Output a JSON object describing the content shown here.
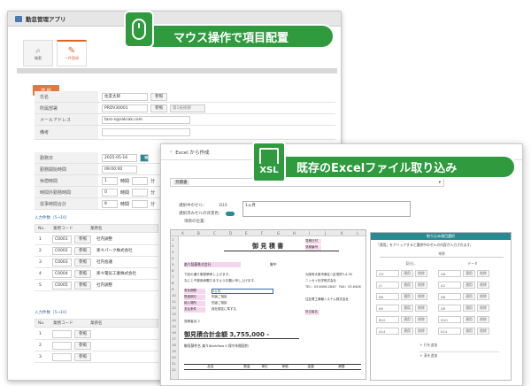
{
  "back_app": {
    "title": "勤怠管理アプリ",
    "tabs": [
      {
        "label": "検索",
        "icon": "search-icon"
      },
      {
        "label": "一件登録",
        "icon": "edit-icon"
      }
    ],
    "register_button": "登 録",
    "fields": [
      {
        "label": "氏名",
        "value": "住友太郎",
        "button": "参照"
      },
      {
        "label": "所属部署",
        "value": "PRDV30001",
        "button": "参照",
        "note": "第1技術部"
      },
      {
        "label": "メールアドレス",
        "value": "taro-s@rakrak.com"
      },
      {
        "label": "備考",
        "value": ""
      }
    ],
    "work_fields": [
      {
        "label": "勤務日",
        "value": "2025-05-16"
      },
      {
        "label": "勤務開始時間",
        "value": "09:00:00"
      },
      {
        "label": "休憩時間",
        "value": "1",
        "unit1": "時間",
        "unit2": "分"
      },
      {
        "label": "時間外勤務時間",
        "value": "0",
        "unit1": "時間",
        "unit2": "分"
      },
      {
        "label": "従事時間合計",
        "value": "8",
        "unit1": "時間",
        "unit2": "分"
      }
    ],
    "section1_title": "入力件数（5→10）",
    "section1_header": [
      "No.",
      "業務コード",
      "業務名"
    ],
    "section1_rows": [
      {
        "no": "1",
        "code": "C0001",
        "btn": "参照",
        "name": "社内調整"
      },
      {
        "no": "2",
        "code": "C0002",
        "btn": "参照",
        "name": "楽々パーク株式会社"
      },
      {
        "no": "3",
        "code": "C0003",
        "btn": "参照",
        "name": "社内会議"
      },
      {
        "no": "4",
        "code": "C0004",
        "btn": "参照",
        "name": "楽々電気工業株式会社"
      },
      {
        "no": "5",
        "code": "C0005",
        "btn": "参照",
        "name": "社内調整"
      }
    ],
    "section2_title": "入力件数（5→10）",
    "section2_header": [
      "No.",
      "業務コード",
      "業務名"
    ],
    "section2_rows": [
      {
        "no": "1",
        "btn": "参照"
      },
      {
        "no": "2",
        "btn": "参照"
      },
      {
        "no": "3",
        "btn": "参照"
      }
    ]
  },
  "callout_mouse": "マウス操作で項目配置",
  "callout_excel": "既存のExcelファイル取り込み",
  "xsl_label": "XSL",
  "front_app": {
    "title": "Excel から作成",
    "select_label": "見積書",
    "selected_cell_label": "選択中のセル：",
    "selected_cell_value": "D10",
    "cell_value": "1ヵ月",
    "option_label": "選択済みセルの背景色：",
    "output_label": "項目の位置：",
    "sheet": {
      "columns": [
        "A",
        "B",
        "C",
        "D",
        "E",
        "F",
        "G",
        "H",
        "I",
        "J",
        "K",
        "L"
      ],
      "title": "御 見 積 書",
      "client": "楽々製薬株式会社",
      "honorific": "御中",
      "doc_no_label": "見積番号",
      "date_label": "見積日付",
      "address": "大阪府大阪市東区○区須賀3-4-30",
      "company": "ニッセイ化学株式会社",
      "tel": "TEL：03-6406-2840　FAX：03-6406",
      "intro": "下記の通り御見積申し上げます。",
      "intro2": "なにとぞ御用命賜りますようお願い申し上げます。",
      "rows_labels": [
        "有効期間",
        "受渡期日",
        "納入場所",
        "支払条件"
      ],
      "rows_values": [
        "1ヵ月",
        "別途ご相談",
        "別途ご相談",
        "貴社規定に準ずる"
      ],
      "vendor": "住友電工情報システム株式会社",
      "person_label": "担当者名",
      "total": "御見積合計金額 3,755,000 -",
      "subject": "御見積件名 楽々Workflow II 保守年間契約",
      "item_header": [
        "品名",
        "数量",
        "単位",
        "単価",
        "金額",
        "摘要"
      ],
      "approver": "見積者名 2"
    },
    "panel": {
      "header": "取り込み項目選択",
      "desc": "「適用」をクリックすると選択中のセルの内容が入力されます。",
      "group": "単票",
      "col_heads": [
        "見出し",
        "データ"
      ],
      "rows": [
        {
          "a": "G3",
          "b": "G6"
        },
        {
          "a": "J1",
          "b": "A2"
        },
        {
          "a": "B8",
          "b": "D8"
        },
        {
          "a": "B9",
          "b": "D9"
        },
        {
          "a": "B10",
          "b": "D10"
        },
        {
          "a": "A14",
          "b": "K14"
        }
      ],
      "apply": "適用",
      "delete": "削除",
      "add_row": "＋ 行を追加",
      "add_table": "＋ 表を追加"
    }
  }
}
